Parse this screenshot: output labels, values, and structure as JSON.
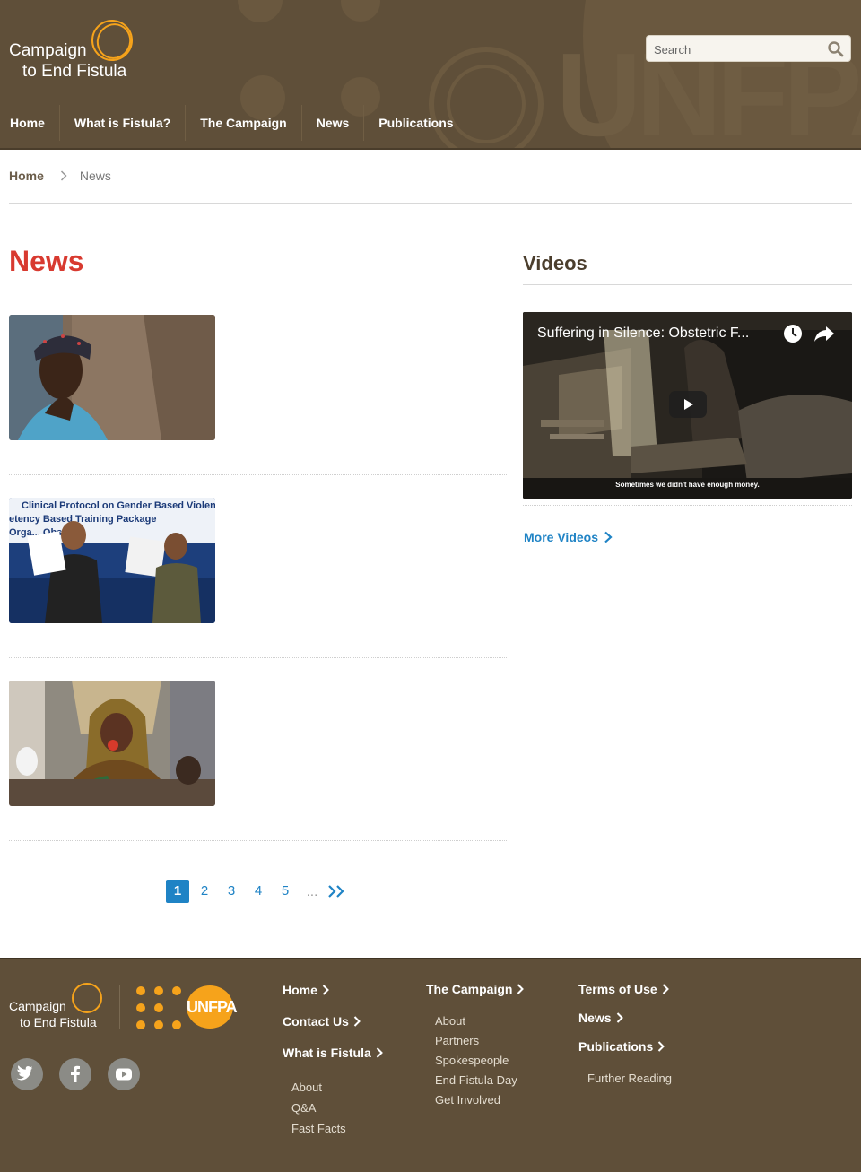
{
  "header": {
    "logo": {
      "line1": "Campaign",
      "line2": "to End Fistula"
    },
    "watermark": "UNFPA",
    "search": {
      "placeholder": "Search",
      "value": ""
    },
    "nav": [
      {
        "label": "Home"
      },
      {
        "label": "What is Fistula?"
      },
      {
        "label": "The Campaign"
      },
      {
        "label": "News"
      },
      {
        "label": "Publications"
      }
    ]
  },
  "breadcrumb": {
    "home": "Home",
    "current": "News"
  },
  "main": {
    "title": "News",
    "items": [
      {
        "image": "girl-portrait-photo"
      },
      {
        "image": "clinical-protocol-launch-photo",
        "image_text": "Clinical Protocol on Gender Based Violence"
      },
      {
        "image": "woman-speaking-microphone-photo"
      }
    ],
    "pagination": {
      "pages": [
        "1",
        "2",
        "3",
        "4",
        "5"
      ],
      "current": "1",
      "ellipsis": "...",
      "next": ">>"
    }
  },
  "sidebar": {
    "videos_title": "Videos",
    "video": {
      "title": "Suffering in Silence: Obstetric F...",
      "caption": "Sometimes we didn't have enough money."
    },
    "more_videos": "More Videos"
  },
  "footer": {
    "logo": {
      "line1": "Campaign",
      "line2": "to End Fistula"
    },
    "partner_logo": "UNFPA",
    "social": [
      "twitter-icon",
      "facebook-icon",
      "youtube-icon"
    ],
    "col1": {
      "links": [
        "Home",
        "Contact Us",
        "What is Fistula"
      ],
      "sub": [
        "About",
        "Q&A",
        "Fast Facts"
      ]
    },
    "col2": {
      "head": "The Campaign",
      "sub": [
        "About",
        "Partners",
        "Spokespeople",
        "End Fistula Day",
        "Get Involved"
      ]
    },
    "col3": {
      "links": [
        "Terms of Use",
        "News",
        "Publications"
      ],
      "sub": [
        "Further Reading"
      ]
    }
  },
  "colors": {
    "brand_brown": "#5f4f39",
    "accent_orange": "#f6a31b",
    "news_red": "#d83a30",
    "link_blue": "#1f83c5"
  }
}
